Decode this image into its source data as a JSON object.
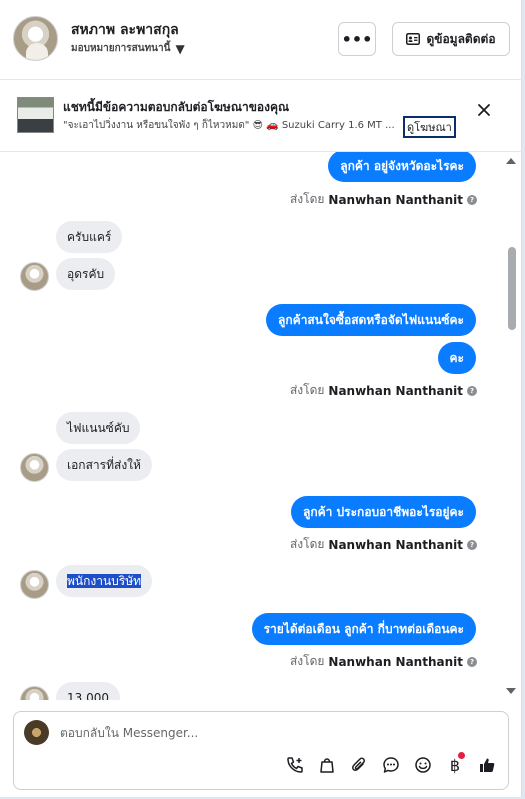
{
  "header": {
    "contact_name": "สหภาพ ละพาสกุล",
    "assign_label": "มอบหมายการสนทนานี้",
    "more_label": "•••",
    "contact_info_label": "ดูข้อมูลติดต่อ"
  },
  "banner": {
    "title": "แชทนี้มีข้อความตอบกลับต่อโฆษณาของคุณ",
    "subtitle": "\"จะเอาไปวิ่งงาน หรือขนใจพัง ๆ ก็ไหวหมด\" 😎 🚗 Suzuki Carry 1.6 MT ...",
    "link_label": "ดูโฆษณา"
  },
  "messages": {
    "m1": "ลูกค้า อยู่จังหวัดอะไรคะ",
    "sent_prefix": "ส่งโดย",
    "sender": "Nanwhan Nanthanit",
    "m2": "ครับแคร์",
    "m3": "อุดรคับ",
    "m4": "ลูกค้าสนใจซื้อสดหรือจัดไฟแนนซ์คะ",
    "m5": "คะ",
    "m6": "ไฟแนนซ์คับ",
    "m7": "เอกสารที่ส่งให้",
    "m8": "ลูกค้า ประกอบอาชีพอะไรอยู่คะ",
    "m9": "พนักงานบริษัท",
    "m10": "รายได้ต่อเดือน ลูกค้า กี่บาทต่อเดือนคะ",
    "m11": "13,000"
  },
  "composer": {
    "placeholder": "ตอบกลับใน Messenger..."
  },
  "icons": {
    "more": "more-horizontal-icon",
    "contact": "id-card-icon",
    "close": "close-icon",
    "help": "question-icon",
    "call": "phone-add-icon",
    "bag": "shopping-bag-icon",
    "attach": "paperclip-icon",
    "saved_reply": "chat-bubble-icon",
    "emoji": "smiley-icon",
    "payment": "baht-icon",
    "like": "thumbs-up-icon"
  },
  "colors": {
    "accent": "#0a7cff",
    "incoming_bubble": "#ebedf0",
    "notification_dot": "#e41e3f"
  }
}
